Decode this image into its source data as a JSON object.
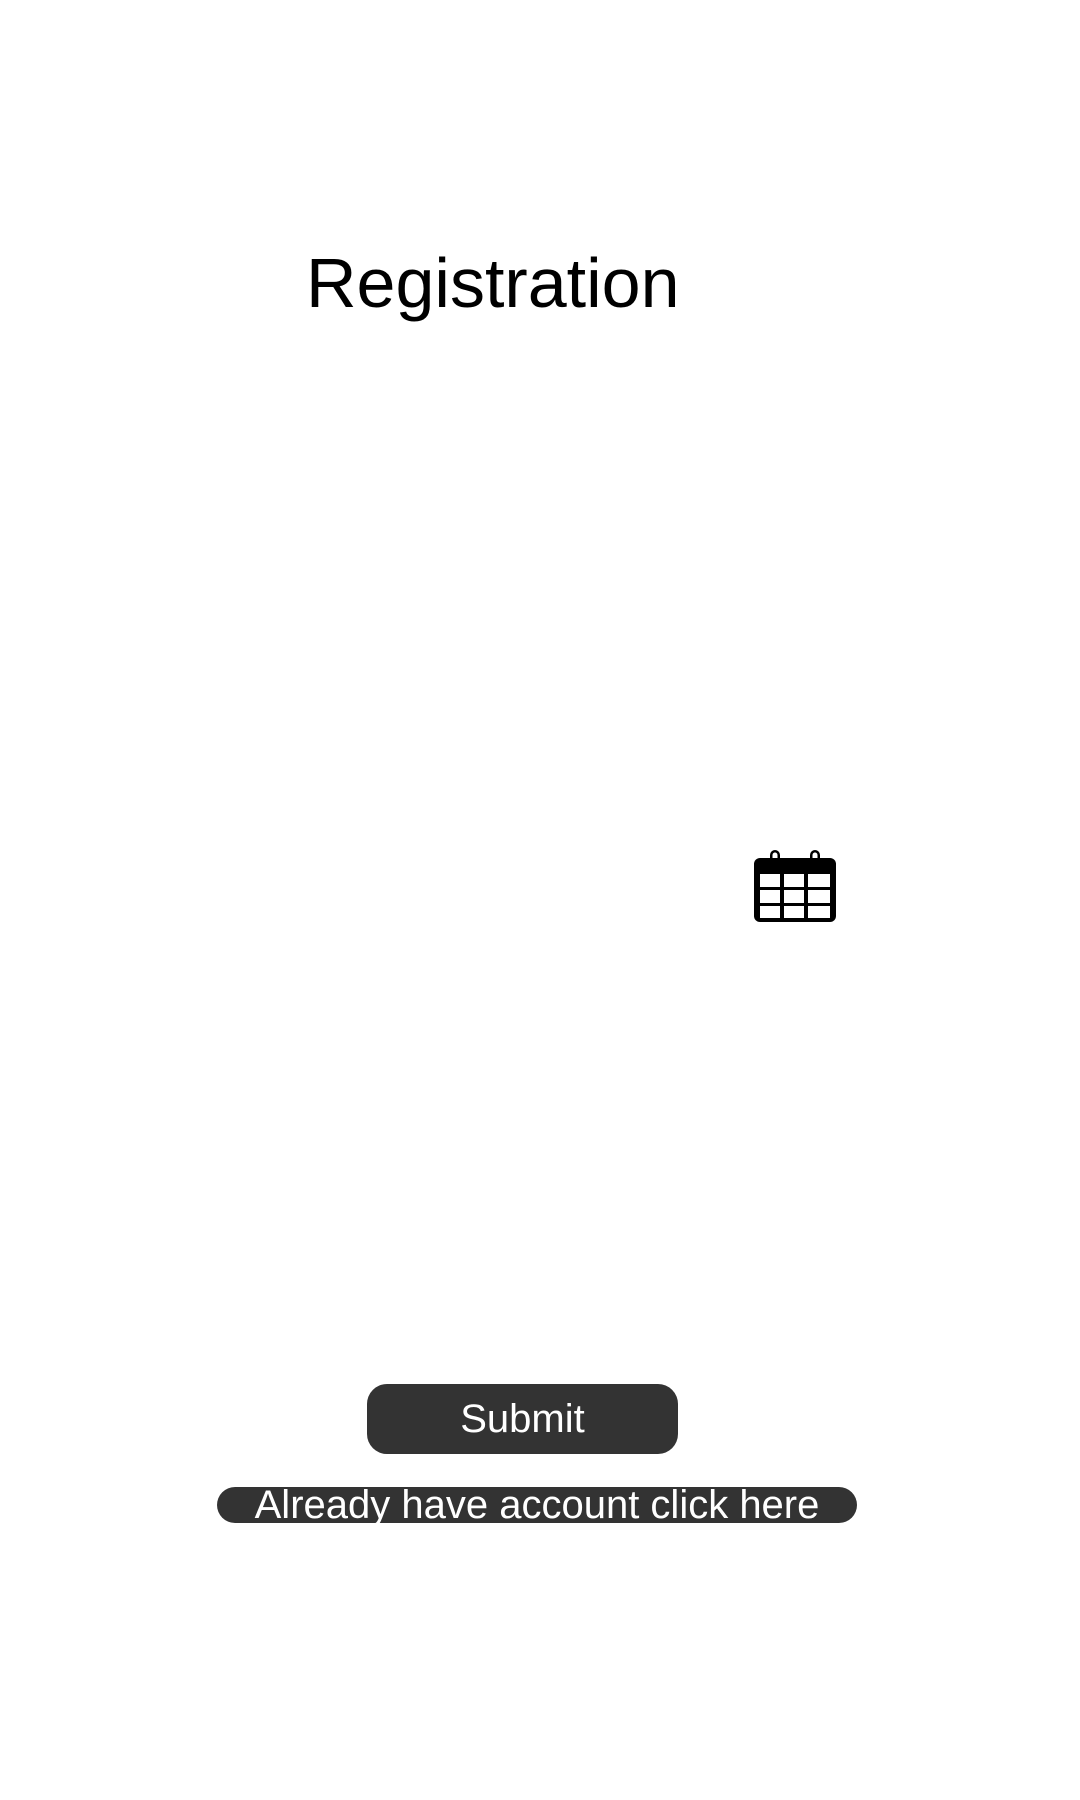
{
  "page": {
    "title": "Registration"
  },
  "date_picker": {
    "icon": "calendar-icon"
  },
  "actions": {
    "submit_label": "Submit",
    "login_link_label": "Already have account click here"
  },
  "colors": {
    "background": "#ffffff",
    "button_bg": "#333333",
    "button_text": "#ffffff",
    "title_text": "#000000"
  }
}
